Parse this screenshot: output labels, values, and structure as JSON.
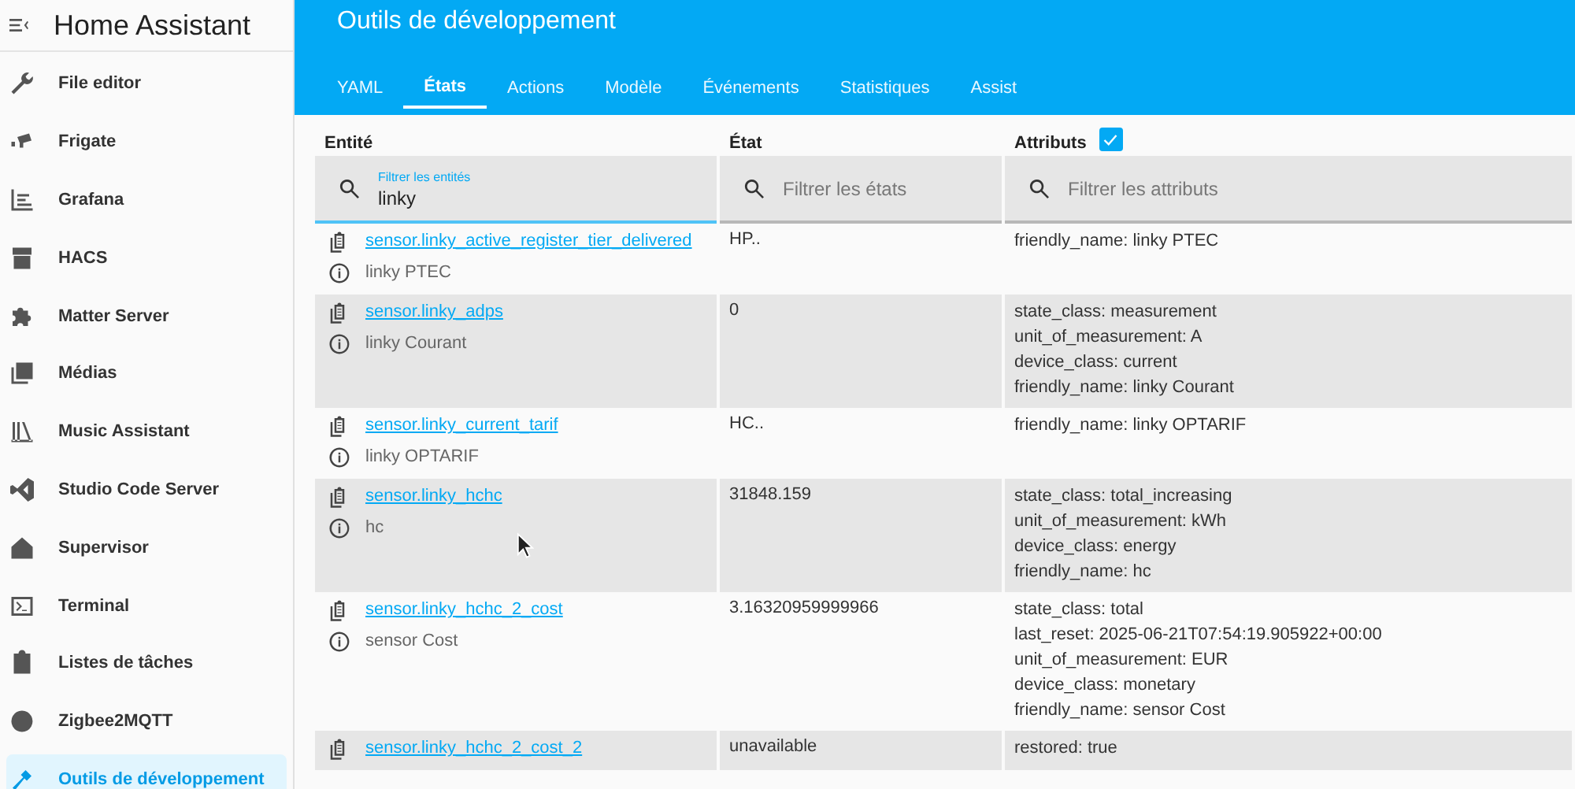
{
  "sidebar": {
    "title": "Home Assistant",
    "items": [
      {
        "label": "File editor",
        "selected": false
      },
      {
        "label": "Frigate",
        "selected": false
      },
      {
        "label": "Grafana",
        "selected": false
      },
      {
        "label": "HACS",
        "selected": false
      },
      {
        "label": "Matter Server",
        "selected": false
      },
      {
        "label": "Médias",
        "selected": false
      },
      {
        "label": "Music Assistant",
        "selected": false
      },
      {
        "label": "Studio Code Server",
        "selected": false
      },
      {
        "label": "Supervisor",
        "selected": false
      },
      {
        "label": "Terminal",
        "selected": false
      },
      {
        "label": "Listes de tâches",
        "selected": false
      },
      {
        "label": "Zigbee2MQTT",
        "selected": false
      },
      {
        "label": "Outils de développement",
        "selected": true
      }
    ]
  },
  "header": {
    "title": "Outils de développement",
    "tabs": [
      {
        "label": "YAML",
        "selected": false
      },
      {
        "label": "États",
        "selected": true
      },
      {
        "label": "Actions",
        "selected": false
      },
      {
        "label": "Modèle",
        "selected": false
      },
      {
        "label": "Événements",
        "selected": false
      },
      {
        "label": "Statistiques",
        "selected": false
      },
      {
        "label": "Assist",
        "selected": false
      }
    ]
  },
  "table": {
    "columns": [
      {
        "label": "Entité"
      },
      {
        "label": "État"
      },
      {
        "label": "Attributs",
        "checkbox": {
          "checked": true
        }
      }
    ],
    "filters": [
      {
        "label": "Filtrer les entités",
        "value": "linky",
        "focused": true
      },
      {
        "placeholder": "Filtrer les états",
        "focused": false
      },
      {
        "placeholder": "Filtrer les attributs",
        "focused": false
      }
    ],
    "rows": [
      {
        "entity": "sensor.linky_active_register_tier_delivered",
        "name": "linky PTEC",
        "state": "HP..",
        "attributes": [
          "friendly_name: linky PTEC"
        ]
      },
      {
        "entity": "sensor.linky_adps",
        "name": "linky Courant",
        "state": "0",
        "attributes": [
          "state_class: measurement",
          "unit_of_measurement: A",
          "device_class: current",
          "friendly_name: linky Courant"
        ]
      },
      {
        "entity": "sensor.linky_current_tarif",
        "name": "linky OPTARIF",
        "state": "HC..",
        "attributes": [
          "friendly_name: linky OPTARIF"
        ]
      },
      {
        "entity": "sensor.linky_hchc",
        "name": "hc",
        "state": "31848.159",
        "attributes": [
          "state_class: total_increasing",
          "unit_of_measurement: kWh",
          "device_class: energy",
          "friendly_name: hc"
        ]
      },
      {
        "entity": "sensor.linky_hchc_2_cost",
        "name": "sensor Cost",
        "state": "3.16320959999966",
        "attributes": [
          "state_class: total",
          "last_reset: 2025-06-21T07:54:19.905922+00:00",
          "unit_of_measurement: EUR",
          "device_class: monetary",
          "friendly_name: sensor Cost"
        ]
      },
      {
        "entity": "sensor.linky_hchc_2_cost_2",
        "state": "unavailable",
        "attributes": [
          "restored: true"
        ]
      }
    ]
  }
}
